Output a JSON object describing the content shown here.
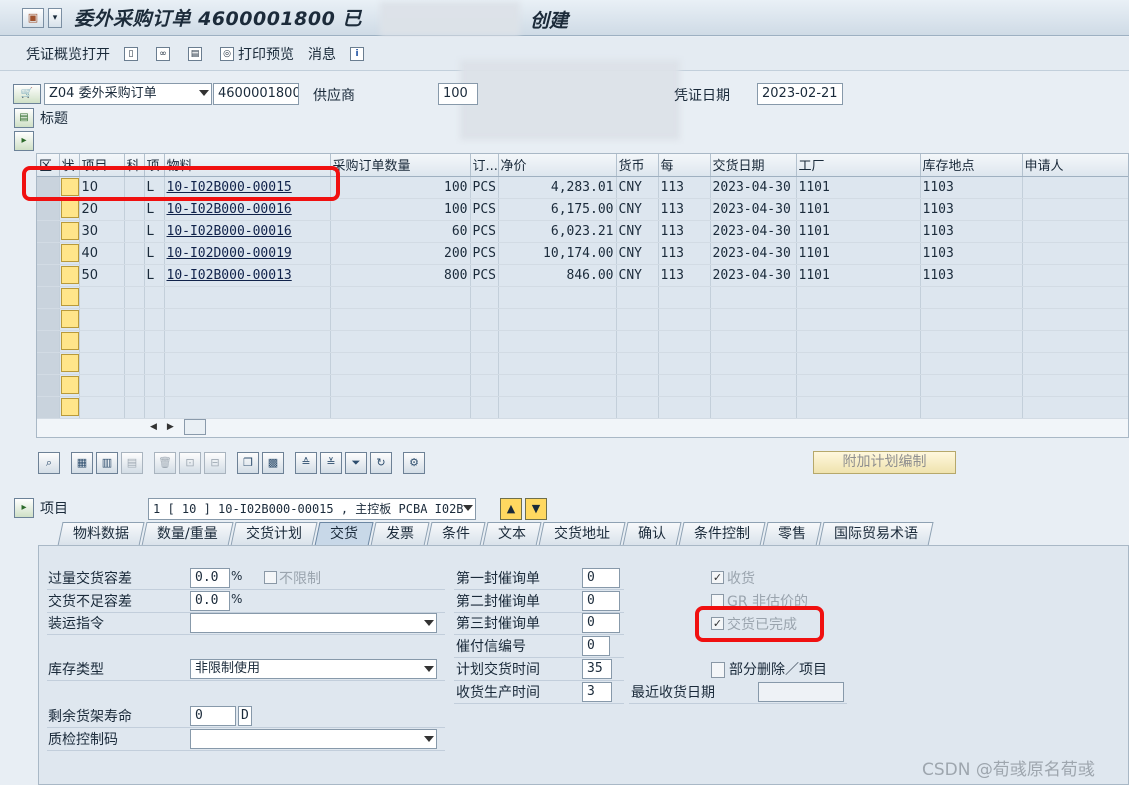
{
  "window": {
    "title_start": "委外采购订单 4600001800 已",
    "title_end": "创建"
  },
  "toolbar": {
    "overview_label": "凭证概览打开",
    "print_preview_label": "打印预览",
    "messages_label": "消息"
  },
  "header": {
    "doc_type": "Z04 委外采购订单",
    "doc_number": "4600001800",
    "vendor_label": "供应商",
    "vendor_value": "100",
    "doc_date_label": "凭证日期",
    "doc_date_value": "2023-02-21",
    "title_section_label": "标题"
  },
  "table": {
    "columns": [
      "区",
      "状",
      "项目",
      "科",
      "项",
      "物料",
      "采购订单数量",
      "订...",
      "净价",
      "货币",
      "每",
      "交货日期",
      "工厂",
      "库存地点",
      "申请人"
    ],
    "rows": [
      {
        "item": "10",
        "acct": "L",
        "material": "10-I02B000-00015",
        "qty": "100",
        "unit": "PCS",
        "price": "4,283.01",
        "currency": "CNY",
        "per": "113",
        "delivery": "2023-04-30",
        "plant": "1101",
        "sloc": "1103"
      },
      {
        "item": "20",
        "acct": "L",
        "material": "10-I02B000-00016",
        "qty": "100",
        "unit": "PCS",
        "price": "6,175.00",
        "currency": "CNY",
        "per": "113",
        "delivery": "2023-04-30",
        "plant": "1101",
        "sloc": "1103"
      },
      {
        "item": "30",
        "acct": "L",
        "material": "10-I02B000-00016",
        "qty": "60",
        "unit": "PCS",
        "price": "6,023.21",
        "currency": "CNY",
        "per": "113",
        "delivery": "2023-04-30",
        "plant": "1101",
        "sloc": "1103"
      },
      {
        "item": "40",
        "acct": "L",
        "material": "10-I02D000-00019",
        "qty": "200",
        "unit": "PCS",
        "price": "10,174.00",
        "currency": "CNY",
        "per": "113",
        "delivery": "2023-04-30",
        "plant": "1101",
        "sloc": "1103"
      },
      {
        "item": "50",
        "acct": "L",
        "material": "10-I02B000-00013",
        "qty": "800",
        "unit": "PCS",
        "price": "846.00",
        "currency": "CNY",
        "per": "113",
        "delivery": "2023-04-30",
        "plant": "1101",
        "sloc": "1103"
      }
    ]
  },
  "plan_button_label": "附加计划编制",
  "item_section": {
    "label": "项目",
    "selected": "1 [ 10 ] 10-I02B000-00015 , 主控板 PCBA I02B"
  },
  "tabs": [
    "物料数据",
    "数量/重量",
    "交货计划",
    "交货",
    "发票",
    "条件",
    "文本",
    "交货地址",
    "确认",
    "条件控制",
    "零售",
    "国际贸易术语"
  ],
  "delivery_tab": {
    "overdelivery_label": "过量交货容差",
    "overdelivery_value": "0.0",
    "underdelivery_label": "交货不足容差",
    "underdelivery_value": "0.0",
    "percent": "%",
    "unlimited_label": "不限制",
    "shipping_instr_label": "装运指令",
    "stock_type_label": "库存类型",
    "stock_type_value": "非限制使用",
    "shelf_life_label": "剩余货架寿命",
    "shelf_life_value": "0",
    "shelf_life_unit": "D",
    "qi_control_label": "质检控制码",
    "reminder1_label": "第一封催询单",
    "reminder1_value": "0",
    "reminder2_label": "第二封催询单",
    "reminder2_value": "0",
    "reminder3_label": "第三封催询单",
    "reminder3_value": "0",
    "urge_no_label": "催付信编号",
    "urge_no_value": "0",
    "planned_delivery_label": "计划交货时间",
    "planned_delivery_value": "35",
    "gr_proc_time_label": "收货生产时间",
    "gr_proc_time_value": "3",
    "last_gr_date_label": "最近收货日期",
    "gr_label": "收货",
    "gr_non_valuated_label": "GR 非估价的",
    "delivery_completed_label": "交货已完成",
    "partial_delete_label": "部分删除／项目"
  },
  "watermark": "CSDN @荀彧原名荀彧"
}
